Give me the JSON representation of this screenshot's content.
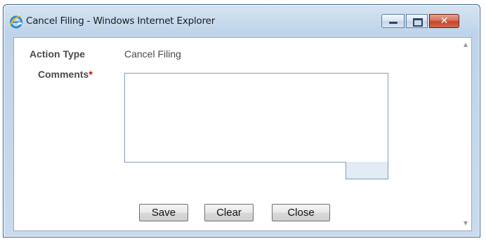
{
  "window": {
    "title": "Cancel Filing - Windows Internet Explorer",
    "icon": "internet-explorer-icon",
    "controls": {
      "minimize_icon": "minimize-icon",
      "maximize_icon": "maximize-icon",
      "close_glyph": "✕"
    }
  },
  "form": {
    "action_type": {
      "label": "Action Type",
      "value": "Cancel Filing"
    },
    "comments": {
      "label": "Comments",
      "required_marker": "*",
      "value": ""
    }
  },
  "buttons": {
    "save": "Save",
    "clear": "Clear",
    "close": "Close"
  },
  "scrollbar": {
    "up_glyph": "▲",
    "down_glyph": "▼"
  },
  "colors": {
    "frame_border": "#3a5f86",
    "close_button": "#c2452b",
    "required": "#cc0000",
    "label_text": "#4a4a4a"
  }
}
